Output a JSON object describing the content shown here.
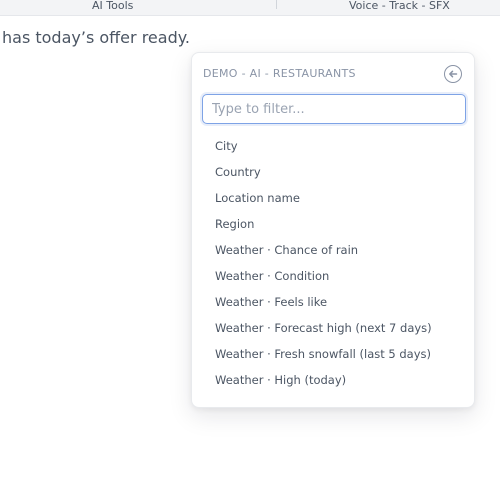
{
  "topbar": {
    "tabs": [
      {
        "label": "AI Tools"
      },
      {
        "label": "Voice - Track - SFX"
      }
    ]
  },
  "background_text": "has today’s offer ready.",
  "popover": {
    "title": "DEMO - AI - RESTAURANTS",
    "back_icon": "circle-arrow-left-icon",
    "filter": {
      "placeholder": "Type to filter...",
      "value": ""
    },
    "items": [
      {
        "label": "City"
      },
      {
        "label": "Country"
      },
      {
        "label": "Location name"
      },
      {
        "label": "Region"
      },
      {
        "label": "Weather · Chance of rain"
      },
      {
        "label": "Weather · Condition"
      },
      {
        "label": "Weather · Feels like"
      },
      {
        "label": "Weather · Forecast high (next 7 days)"
      },
      {
        "label": "Weather · Fresh snowfall (last 5 days)"
      },
      {
        "label": "Weather · High (today)"
      }
    ]
  },
  "colors": {
    "accent_border": "#7ea3e6",
    "muted_text": "#8a94a6",
    "item_text": "#4b5563"
  }
}
